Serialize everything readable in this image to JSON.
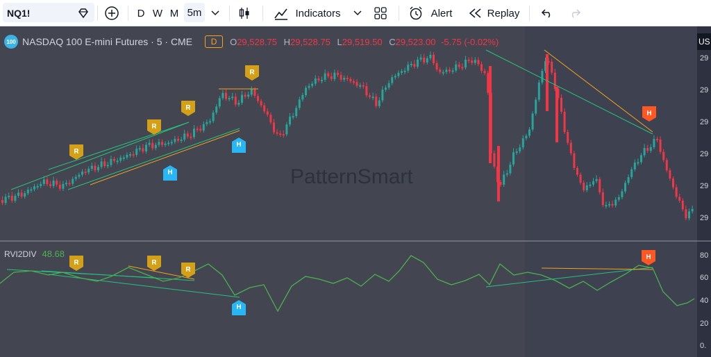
{
  "toolbar": {
    "symbol": "NQ1!",
    "intervals": [
      "D",
      "W",
      "M",
      "5m"
    ],
    "selected_interval": "5m",
    "indicators_label": "Indicators",
    "alert_label": "Alert",
    "replay_label": "Replay"
  },
  "legend": {
    "logo_text": "100",
    "title": "NASDAQ 100 E-mini Futures · 5 · CME",
    "d_badge": "D",
    "o_key": "O",
    "o_val": "29,528.75",
    "h_key": "H",
    "h_val": "29,528.75",
    "l_key": "L",
    "l_val": "29,519.50",
    "c_key": "C",
    "c_val": "29,523.00",
    "change": "-5.75 (-0.02%)"
  },
  "price_axis": {
    "currency": "US",
    "labels": [
      "29",
      "29",
      "29",
      "29",
      "29",
      "29"
    ]
  },
  "indicator": {
    "name": "RVI2DIV",
    "value": "48.68",
    "axis_labels": [
      "80",
      "60",
      "40",
      "20",
      "0."
    ]
  },
  "watermark": "PatternSmart",
  "markers": {
    "regular": "R",
    "hidden": "H"
  },
  "colors": {
    "background": "#434651",
    "highlight": "#3e4250",
    "up": "#26a69a",
    "down": "#f23645",
    "rvi_line": "#4caf50",
    "regular_marker": "#d4a017",
    "hidden_bear_marker": "#ff5722",
    "hidden_bull_marker": "#29b6f6",
    "div_line_orange": "#f7a21b",
    "div_line_green": "#26c281"
  }
}
